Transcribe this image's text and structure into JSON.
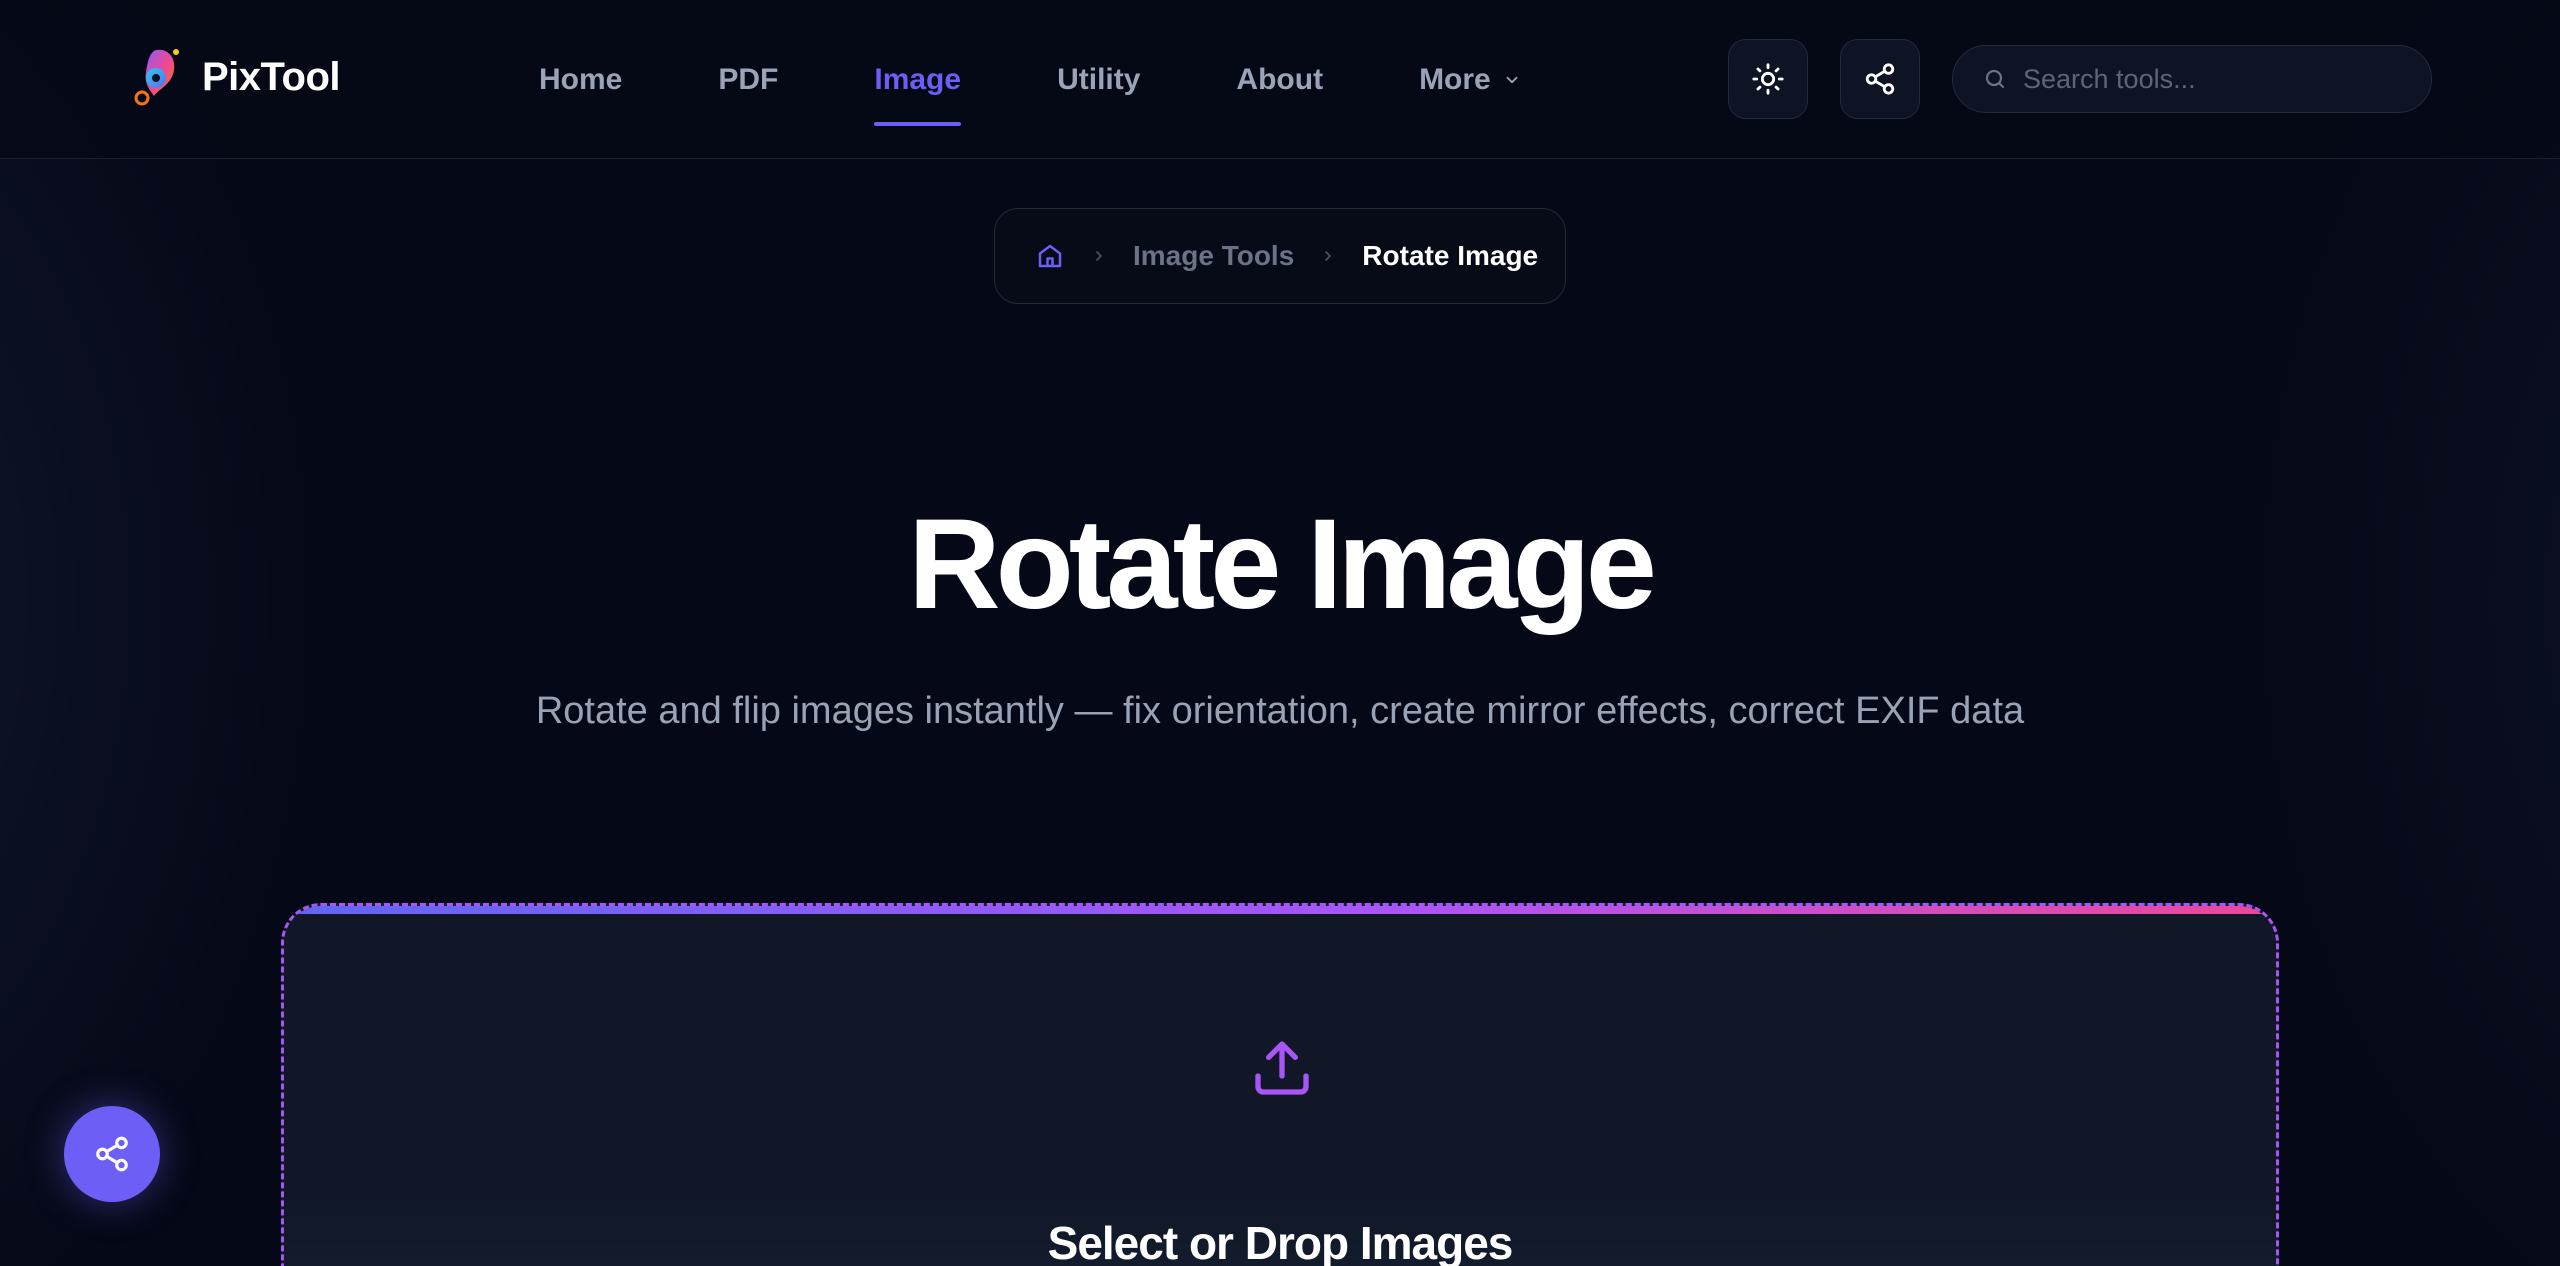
{
  "brand": {
    "name": "PixTool"
  },
  "nav": {
    "items": [
      {
        "label": "Home",
        "active": false
      },
      {
        "label": "PDF",
        "active": false
      },
      {
        "label": "Image",
        "active": true
      },
      {
        "label": "Utility",
        "active": false
      },
      {
        "label": "About",
        "active": false
      }
    ],
    "more_label": "More"
  },
  "toolbar": {
    "theme_icon": "sun-icon",
    "share_icon": "share-icon"
  },
  "search": {
    "placeholder": "Search tools..."
  },
  "breadcrumb": {
    "home_icon": "home-icon",
    "items": [
      "Image Tools",
      "Rotate Image"
    ]
  },
  "hero": {
    "title": "Rotate Image",
    "subtitle": "Rotate and flip images instantly — fix orientation, create mirror effects, correct EXIF data"
  },
  "dropzone": {
    "icon": "upload-icon",
    "title": "Select or Drop Images"
  },
  "fab": {
    "icon": "share-icon"
  },
  "colors": {
    "background": "#050816",
    "accent": "#6d5ef6",
    "dropzone_border": "#a855f7",
    "gradient": [
      "#6366f1",
      "#a855f7",
      "#ec4899"
    ]
  }
}
